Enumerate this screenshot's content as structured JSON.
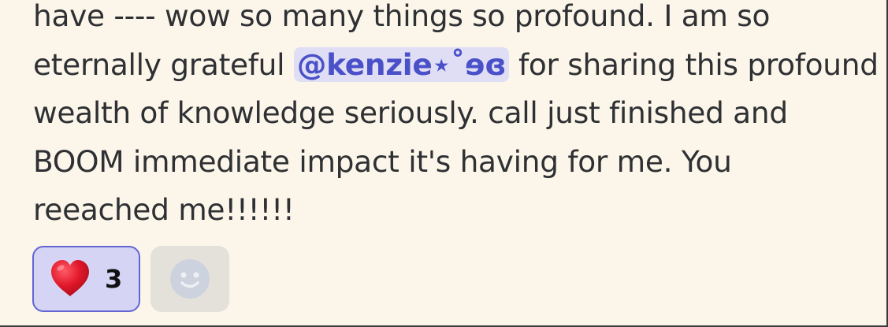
{
  "message": {
    "line1": "have ---- wow so many things so profound. I am so",
    "line2_before": "eternally grateful ",
    "mention": "@kenzie⋆˚ɘɞ",
    "line2_after": " for sharing this profound",
    "line3": "wealth of knowledge seriously. call just finished and",
    "line4": "BOOM immediate impact it's having for me. You",
    "line5": "reeached me!!!!!!"
  },
  "reactions": [
    {
      "emoji": "heart-icon",
      "count": "3",
      "active": true
    }
  ],
  "add_reaction": {
    "icon": "smile-face-icon"
  },
  "colors": {
    "background": "#fcf6ea",
    "mention_bg": "#dfdef5",
    "mention_text": "#4a50c8",
    "reaction_active_bg": "#d6d4f4",
    "reaction_active_border": "#6266d4",
    "heart": "#e0182a"
  }
}
